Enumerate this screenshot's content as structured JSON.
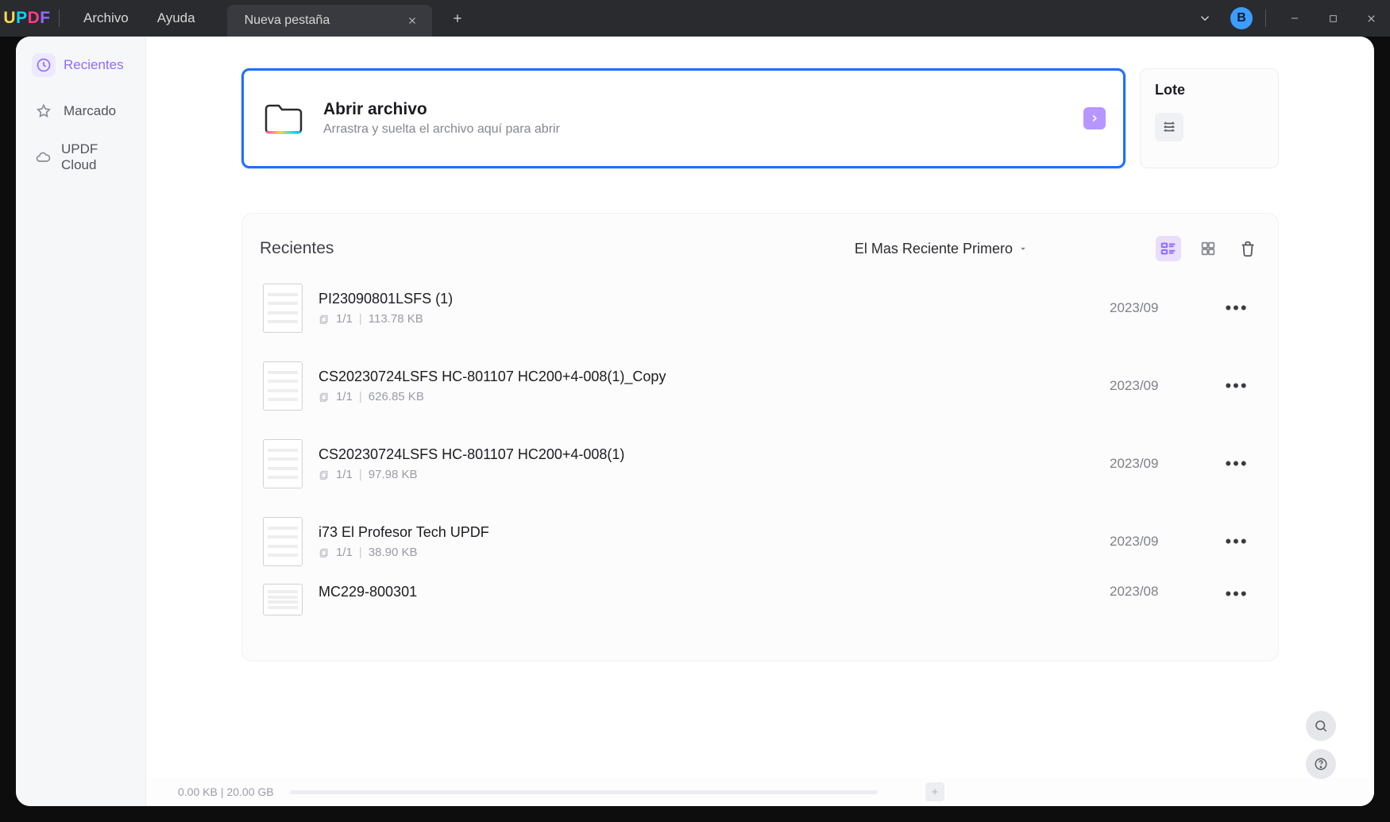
{
  "app": {
    "logo_letters": [
      "U",
      "P",
      "D",
      "F"
    ]
  },
  "menu": {
    "archivo": "Archivo",
    "ayuda": "Ayuda"
  },
  "tab": {
    "title": "Nueva pestaña"
  },
  "avatar": {
    "initial": "B"
  },
  "sidebar": {
    "items": [
      {
        "label": "Recientes"
      },
      {
        "label": "Marcado"
      },
      {
        "label": "UPDF Cloud"
      }
    ]
  },
  "open_box": {
    "title": "Abrir archivo",
    "subtitle": "Arrastra y suelta el archivo aquí para abrir"
  },
  "batch": {
    "title": "Lote"
  },
  "recents": {
    "title": "Recientes",
    "sort_label": "El Mas Reciente Primero",
    "files": [
      {
        "name": "PI23090801LSFS (1)",
        "pages": "1/1",
        "size": "113.78 KB",
        "date": "2023/09"
      },
      {
        "name": "CS20230724LSFS      HC-801107   HC200+4-008(1)_Copy",
        "pages": "1/1",
        "size": "626.85 KB",
        "date": "2023/09"
      },
      {
        "name": "CS20230724LSFS      HC-801107   HC200+4-008(1)",
        "pages": "1/1",
        "size": "97.98 KB",
        "date": "2023/09"
      },
      {
        "name": "i73 El Profesor Tech UPDF",
        "pages": "1/1",
        "size": "38.90 KB",
        "date": "2023/09"
      },
      {
        "name": "MC229-800301",
        "pages": "",
        "size": "",
        "date": "2023/08"
      }
    ]
  },
  "storage": {
    "used": "0.00 KB",
    "total": "20.00 GB"
  }
}
